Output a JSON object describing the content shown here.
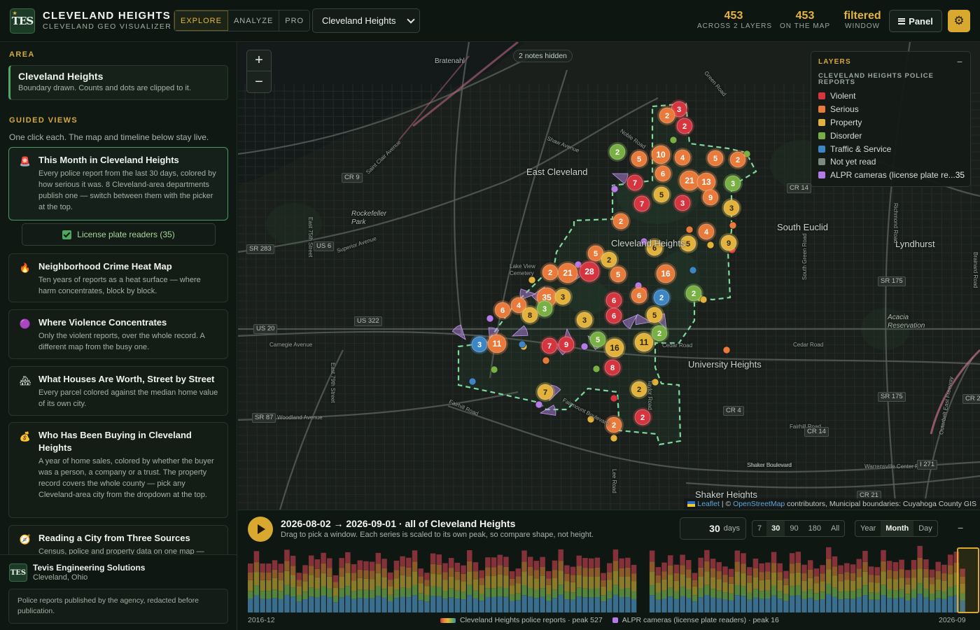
{
  "header": {
    "logo_text": "TES",
    "title": "CLEVELAND HEIGHTS",
    "subtitle": "CLEVELAND GEO VISUALIZER",
    "modes": [
      {
        "label": "EXPLORE",
        "active": true
      },
      {
        "label": "ANALYZE",
        "active": false
      },
      {
        "label": "PRO",
        "active": false
      }
    ],
    "city_select": "Cleveland Heights",
    "stats": [
      {
        "value": "453",
        "label": "ACROSS 2 LAYERS"
      },
      {
        "value": "453",
        "label": "ON THE MAP"
      },
      {
        "value": "filtered",
        "label": "WINDOW"
      }
    ],
    "panel_label": "Panel",
    "settings_icon": "gear-icon"
  },
  "sidebar": {
    "area_title": "AREA",
    "area_card": {
      "title": "Cleveland Heights",
      "desc": "Boundary drawn. Counts and dots are clipped to it."
    },
    "guided_title": "GUIDED VIEWS",
    "guided_sub": "One click each. The map and timeline below stay live.",
    "lpr_toggle": "License plate readers (35)",
    "views": [
      {
        "icon": "siren-icon",
        "glyph": "🚨",
        "title": "This Month in Cleveland Heights",
        "desc": "Every police report from the last 30 days, colored by how serious it was. 8 Cleveland-area departments publish one — switch between them with the picker at the top.",
        "active": true
      },
      {
        "icon": "fire-icon",
        "glyph": "🔥",
        "title": "Neighborhood Crime Heat Map",
        "desc": "Ten years of reports as a heat surface — where harm concentrates, block by block.",
        "active": false
      },
      {
        "icon": "purple-circle-icon",
        "glyph": "🟣",
        "title": "Where Violence Concentrates",
        "desc": "Only the violent reports, over the whole record. A different map from the busy one.",
        "active": false
      },
      {
        "icon": "house-icon",
        "glyph": "🏘",
        "title": "What Houses Are Worth, Street by Street",
        "desc": "Every parcel colored against the median home value of its own city.",
        "active": false
      },
      {
        "icon": "money-bag-icon",
        "glyph": "💰",
        "title": "Who Has Been Buying in Cleveland Heights",
        "desc": "A year of home sales, colored by whether the buyer was a person, a company or a trust. The property record covers the whole county — pick any Cleveland-area city from the dropdown at the top.",
        "active": false
      },
      {
        "icon": "compass-icon",
        "glyph": "🧭",
        "title": "Reading a City from Three Sources",
        "desc": "Census, police and property data on one map —",
        "active": false
      }
    ],
    "footer": {
      "logo_text": "TES",
      "name": "Tevis Engineering Solutions",
      "location": "Cleveland, Ohio",
      "note": "Police reports published by the agency, redacted before publication."
    }
  },
  "map": {
    "notes_hidden": "2 notes hidden",
    "zoom_in": "+",
    "zoom_out": "−",
    "places": [
      {
        "name": "East Cleveland",
        "size": "big"
      },
      {
        "name": "Cleveland Heights",
        "size": "big"
      },
      {
        "name": "South Euclid",
        "size": "big"
      },
      {
        "name": "Lyndhurst",
        "size": "big"
      },
      {
        "name": "University Heights",
        "size": "big"
      },
      {
        "name": "Shaker Heights",
        "size": "big"
      },
      {
        "name": "Bratenahl",
        "size": "small"
      },
      {
        "name": "Rockefeller Park",
        "size": "small"
      },
      {
        "name": "Acacia Reservation",
        "size": "small"
      },
      {
        "name": "Lake View Cemetery",
        "size": "small"
      }
    ],
    "roads": [
      "Superior Avenue",
      "Saint Clair Avenue",
      "Shaw Avenue",
      "Noble Road",
      "Green Road",
      "Carnegie Avenue",
      "Woodland Avenue",
      "Fairmount Boulevard",
      "Cedar Road",
      "Shaker Boulevard",
      "Fairhill Road",
      "East 79th Street",
      "East 75th Street",
      "Lee Road",
      "Taylor Road",
      "South Green Road",
      "Warrensville Center Road",
      "Richmond Road",
      "Brainard Road",
      "Outerbelt East Freeway"
    ],
    "route_labels": [
      "CR 9",
      "US 6",
      "SR 283",
      "US 20",
      "US 322",
      "SR 87",
      "CR 14",
      "SR 175",
      "CR 4",
      "I 271",
      "CR 21",
      "CR 2"
    ],
    "legend": {
      "title": "LAYERS",
      "group": "CLEVELAND HEIGHTS POLICE REPORTS",
      "minimize": "−",
      "items": [
        {
          "label": "Violent",
          "color": "#d6343f"
        },
        {
          "label": "Serious",
          "color": "#e97a3a"
        },
        {
          "label": "Property",
          "color": "#e2b23a"
        },
        {
          "label": "Disorder",
          "color": "#78b043"
        },
        {
          "label": "Traffic & Service",
          "color": "#3d86c6"
        },
        {
          "label": "Not yet read",
          "color": "#7d8a82"
        },
        {
          "label": "ALPR cameras (license plate re...",
          "color": "#b57bea",
          "count": "35"
        }
      ]
    },
    "attribution": {
      "leaflet": "Leaflet",
      "sep": " | © ",
      "osm": "OpenStreetMap",
      "rest": " contributors, Municipal boundaries: Cuyahoga County GIS"
    },
    "clusters": [
      {
        "n": 3,
        "c": "violent"
      },
      {
        "n": 2,
        "c": "serious"
      },
      {
        "n": 2,
        "c": "violent"
      },
      {
        "n": 2,
        "c": "disorder"
      },
      {
        "n": 5,
        "c": "serious"
      },
      {
        "n": 10,
        "c": "serious"
      },
      {
        "n": 4,
        "c": "serious"
      },
      {
        "n": 5,
        "c": "serious"
      },
      {
        "n": 2,
        "c": "serious"
      },
      {
        "n": 7,
        "c": "violent"
      },
      {
        "n": 6,
        "c": "serious"
      },
      {
        "n": 21,
        "c": "serious"
      },
      {
        "n": 13,
        "c": "serious"
      },
      {
        "n": 3,
        "c": "disorder"
      },
      {
        "n": 5,
        "c": "property"
      },
      {
        "n": 9,
        "c": "serious"
      },
      {
        "n": 7,
        "c": "violent"
      },
      {
        "n": 3,
        "c": "violent"
      },
      {
        "n": 3,
        "c": "property"
      },
      {
        "n": 2,
        "c": "serious"
      },
      {
        "n": 4,
        "c": "serious"
      },
      {
        "n": 6,
        "c": "property"
      },
      {
        "n": 5,
        "c": "property"
      },
      {
        "n": 9,
        "c": "property"
      },
      {
        "n": 5,
        "c": "serious"
      },
      {
        "n": 2,
        "c": "property"
      },
      {
        "n": 21,
        "c": "serious"
      },
      {
        "n": 28,
        "c": "violent"
      },
      {
        "n": 5,
        "c": "serious"
      },
      {
        "n": 16,
        "c": "serious"
      },
      {
        "n": 2,
        "c": "serious"
      },
      {
        "n": 35,
        "c": "serious"
      },
      {
        "n": 3,
        "c": "property"
      },
      {
        "n": 2,
        "c": "disorder"
      },
      {
        "n": 6,
        "c": "serious"
      },
      {
        "n": 2,
        "c": "traffic"
      },
      {
        "n": 6,
        "c": "serious"
      },
      {
        "n": 4,
        "c": "serious"
      },
      {
        "n": 3,
        "c": "disorder"
      },
      {
        "n": 8,
        "c": "property"
      },
      {
        "n": 6,
        "c": "violent"
      },
      {
        "n": 6,
        "c": "violent"
      },
      {
        "n": 5,
        "c": "property"
      },
      {
        "n": 3,
        "c": "property"
      },
      {
        "n": 3,
        "c": "traffic"
      },
      {
        "n": 11,
        "c": "serious"
      },
      {
        "n": 7,
        "c": "violent"
      },
      {
        "n": 9,
        "c": "violent"
      },
      {
        "n": 5,
        "c": "disorder"
      },
      {
        "n": 16,
        "c": "property"
      },
      {
        "n": 11,
        "c": "property"
      },
      {
        "n": 2,
        "c": "disorder"
      },
      {
        "n": 8,
        "c": "violent"
      },
      {
        "n": 2,
        "c": "property"
      },
      {
        "n": 7,
        "c": "property"
      },
      {
        "n": 2,
        "c": "serious"
      },
      {
        "n": 2,
        "c": "violent"
      }
    ]
  },
  "timeline": {
    "title": "2026-08-02 → 2026-09-01 · all of Cleveland Heights",
    "subtitle": "Drag to pick a window. Each series is scaled to its own peak, so compare shape, not height.",
    "days_value": "30",
    "days_unit": "days",
    "presets": [
      {
        "label": "7",
        "active": false
      },
      {
        "label": "30",
        "active": true
      },
      {
        "label": "90",
        "active": false
      },
      {
        "label": "180",
        "active": false
      },
      {
        "label": "All",
        "active": false
      }
    ],
    "granularity": [
      {
        "label": "Year",
        "active": false
      },
      {
        "label": "Month",
        "active": true
      },
      {
        "label": "Day",
        "active": false
      }
    ],
    "minimize": "−",
    "axis_start": "2016-12",
    "axis_end": "2026-09",
    "legend_reports": "Cleveland Heights police reports · peak 527",
    "legend_alpr": "ALPR cameras (license plate readers) · peak 16"
  }
}
